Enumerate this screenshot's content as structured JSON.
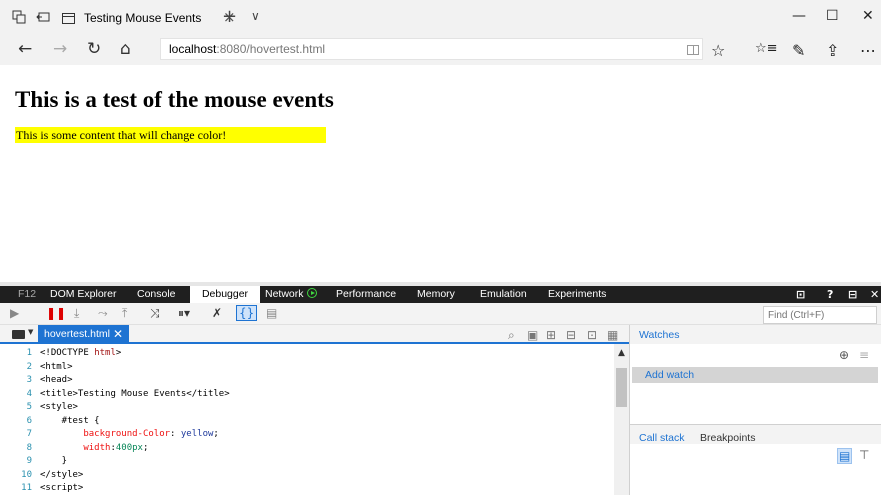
{
  "browser": {
    "tab_title": "Testing Mouse Events",
    "tab_close": "×",
    "new_tab": "+",
    "tab_list": "∨",
    "window_controls": {
      "minimize": "—",
      "maximize": "☐",
      "close": "✕"
    },
    "nav": {
      "back": "←",
      "forward": "→",
      "refresh": "↻",
      "home": "⌂"
    },
    "address": {
      "host": "localhost",
      "rest": ":8080/hovertest.html"
    },
    "icons": {
      "favorite": "☆",
      "favorites_hub": "☆≡",
      "notes": "✎",
      "share": "⇪",
      "more": "⋯",
      "reading_view": "reading-view-icon"
    }
  },
  "page": {
    "heading": "This is a test of the mouse events",
    "test_text": "This is some content that will change color!",
    "highlight_color": "#ffff00"
  },
  "devtools": {
    "tabs": [
      {
        "label": "F12"
      },
      {
        "label": "DOM Explorer"
      },
      {
        "label": "Console"
      },
      {
        "label": "Debugger"
      },
      {
        "label": "Network"
      },
      {
        "label": "Performance"
      },
      {
        "label": "Memory"
      },
      {
        "label": "Emulation"
      },
      {
        "label": "Experiments"
      }
    ],
    "active_tab": "Debugger",
    "right_controls": {
      "console_toggle": "⊡",
      "help": "?",
      "pin": "⊟",
      "close": "✕"
    },
    "find_placeholder": "Find (Ctrl+F)",
    "file_tab": {
      "name": "hovertest.html",
      "close": "✕"
    },
    "code_lines": [
      {
        "n": "1",
        "parts": [
          [
            "",
            "<!DOCTYPE "
          ],
          [
            "kw",
            "html"
          ],
          [
            "",
            ">"
          ]
        ]
      },
      {
        "n": "2",
        "parts": [
          [
            "",
            "<html>"
          ]
        ]
      },
      {
        "n": "3",
        "parts": [
          [
            "",
            "<head>"
          ]
        ]
      },
      {
        "n": "4",
        "parts": [
          [
            "",
            "<title>Testing Mouse Events</title>"
          ]
        ]
      },
      {
        "n": "5",
        "parts": [
          [
            "",
            "<style>"
          ]
        ]
      },
      {
        "n": "6",
        "parts": [
          [
            "",
            "    #test {"
          ]
        ]
      },
      {
        "n": "7",
        "parts": [
          [
            "prop",
            "        background-Color"
          ],
          [
            "",
            ": "
          ],
          [
            "val",
            "yellow"
          ],
          [
            "",
            ";"
          ]
        ]
      },
      {
        "n": "8",
        "parts": [
          [
            "prop",
            "        width"
          ],
          [
            "",
            ":"
          ],
          [
            "num",
            "400px"
          ],
          [
            "",
            ";"
          ]
        ]
      },
      {
        "n": "9",
        "parts": [
          [
            "",
            "    }"
          ]
        ]
      },
      {
        "n": "10",
        "parts": [
          [
            "",
            "</style>"
          ]
        ]
      },
      {
        "n": "11",
        "parts": [
          [
            "",
            "<script>"
          ]
        ]
      }
    ],
    "watches": {
      "title": "Watches",
      "add_watch": "Add watch"
    },
    "bottom_pane": {
      "call_stack": "Call stack",
      "breakpoints": "Breakpoints"
    },
    "accent_color": "#1e73d2"
  }
}
